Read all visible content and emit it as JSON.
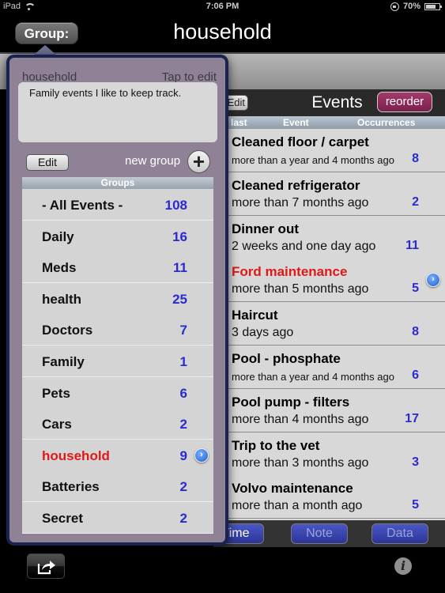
{
  "status_bar": {
    "device": "iPad",
    "time": "7:06 PM",
    "battery": "70%"
  },
  "nav": {
    "group_button": "Group:",
    "title": "household"
  },
  "popover": {
    "group_name": "household",
    "tap_to_edit": "Tap to edit",
    "note": "Family events I like to keep track.",
    "edit_button": "Edit",
    "new_group_label": "new group",
    "new_group_icon": "+",
    "groups_header": "Groups",
    "groups": [
      {
        "name": "- All Events -",
        "count": "108",
        "selected": false
      },
      {
        "name": "Daily",
        "count": "16",
        "selected": false
      },
      {
        "name": "Meds",
        "count": "11",
        "selected": false
      },
      {
        "name": "health",
        "count": "25",
        "selected": false
      },
      {
        "name": "Doctors",
        "count": "7",
        "selected": false
      },
      {
        "name": "Family",
        "count": "1",
        "selected": false
      },
      {
        "name": "Pets",
        "count": "6",
        "selected": false
      },
      {
        "name": "Cars",
        "count": "2",
        "selected": false
      },
      {
        "name": "household",
        "count": "9",
        "selected": true
      },
      {
        "name": "Batteries",
        "count": "2",
        "selected": false
      },
      {
        "name": "Secret",
        "count": "2",
        "selected": false
      }
    ]
  },
  "events": {
    "edit_button": "Edit",
    "title": "Events",
    "reorder_button": "reorder",
    "columns": {
      "last": "last",
      "event": "Event",
      "occurrences": "Occurrences"
    },
    "rows": [
      {
        "name": "Cleaned floor / carpet",
        "last": "more than a year and 4 months ago",
        "count": "8",
        "highlight": false
      },
      {
        "name": "Cleaned refrigerator",
        "last": "more than 7 months ago",
        "count": "2",
        "highlight": false
      },
      {
        "name": "Dinner out",
        "last": "2 weeks and one day ago",
        "count": "11",
        "highlight": false
      },
      {
        "name": "Ford maintenance",
        "last": "more than 5 months ago",
        "count": "5",
        "highlight": true
      },
      {
        "name": "Haircut",
        "last": "3 days ago",
        "count": "8",
        "highlight": false
      },
      {
        "name": "Pool - phosphate",
        "last": "more than a year and 4 months ago",
        "count": "6",
        "highlight": false
      },
      {
        "name": "Pool pump - filters",
        "last": "more than 4 months ago",
        "count": "17",
        "highlight": false
      },
      {
        "name": "Trip to the vet",
        "last": "more than 3 months ago",
        "count": "3",
        "highlight": false
      },
      {
        "name": "Volvo maintenance",
        "last": "more than a month ago",
        "count": "5",
        "highlight": false
      }
    ],
    "toolbar": {
      "time": "Time",
      "note": "Note",
      "data": "Data"
    }
  },
  "bottom": {
    "info_icon": "i"
  },
  "colors": {
    "count_blue": "#2a2ad0",
    "highlight_red": "#e01818",
    "reorder_magenta": "#8f2a5c",
    "popover_purple": "#8f8196",
    "toolbar_blue": "#3a45b0"
  }
}
